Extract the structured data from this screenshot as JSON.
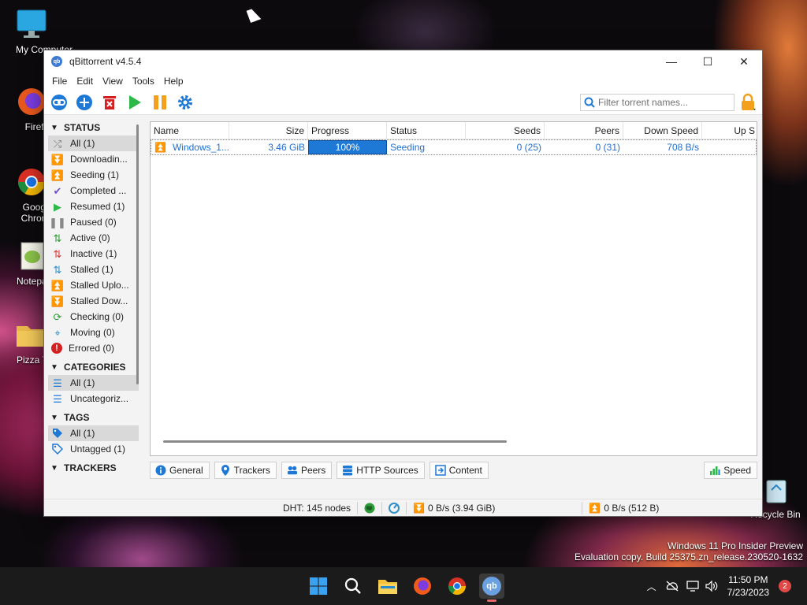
{
  "desktop": {
    "icons": [
      {
        "label": "My Computer",
        "icon": "monitor-icon"
      },
      {
        "label": "Firefox",
        "icon": "firefox-icon"
      },
      {
        "label": "Google Chrome",
        "icon": "chrome-icon"
      },
      {
        "label": "Notepad++",
        "icon": "notepad-icon"
      },
      {
        "label": "Pizza Tower",
        "icon": "folder-icon"
      }
    ],
    "recycle_bin": "Recycle Bin",
    "watermark": {
      "line1": "Windows 11 Pro Insider Preview",
      "line2": "Evaluation copy. Build 25375.zn_release.230520-1632"
    }
  },
  "window": {
    "title": "qBittorrent v4.5.4",
    "app_icon_text": "qb",
    "controls": {
      "minimize": "—",
      "maximize": "☐",
      "close": "✕"
    }
  },
  "menu": [
    "File",
    "Edit",
    "View",
    "Tools",
    "Help"
  ],
  "toolbar": {
    "buttons": [
      "add-link-icon",
      "add-torrent-icon",
      "delete-icon",
      "resume-icon",
      "pause-icon",
      "options-icon"
    ],
    "search_placeholder": "Filter torrent names..."
  },
  "sidebar": {
    "status": {
      "heading": "STATUS",
      "items": [
        {
          "label": "All (1)",
          "icon": "shuffle-icon",
          "color": "#777777",
          "glyph": "⤮",
          "selected": true
        },
        {
          "label": "Downloadin...",
          "icon": "download-icon",
          "color": "#2e9a38",
          "glyph": "⏬"
        },
        {
          "label": "Seeding (1)",
          "icon": "upload-icon",
          "color": "#3a7bd1",
          "glyph": "⏫"
        },
        {
          "label": "Completed ...",
          "icon": "checkmark-icon",
          "color": "#7050c8",
          "glyph": "✔"
        },
        {
          "label": "Resumed (1)",
          "icon": "play-icon",
          "color": "#2eb84a",
          "glyph": "▶"
        },
        {
          "label": "Paused (0)",
          "icon": "pause-icon",
          "color": "#888888",
          "glyph": "❚❚"
        },
        {
          "label": "Active (0)",
          "icon": "active-arrows-icon",
          "color": "#2e9a38",
          "glyph": "⇅"
        },
        {
          "label": "Inactive (1)",
          "icon": "inactive-arrows-icon",
          "color": "#d43a3a",
          "glyph": "⇅"
        },
        {
          "label": "Stalled (1)",
          "icon": "stalled-arrows-icon",
          "color": "#2e8fc8",
          "glyph": "⇅"
        },
        {
          "label": "Stalled Uplo...",
          "icon": "stalled-upload-icon",
          "color": "#3a7bd1",
          "glyph": "⏫"
        },
        {
          "label": "Stalled Dow...",
          "icon": "stalled-download-icon",
          "color": "#2e9a38",
          "glyph": "⏬"
        },
        {
          "label": "Checking (0)",
          "icon": "refresh-icon",
          "color": "#2e9a38",
          "glyph": "⟳"
        },
        {
          "label": "Moving (0)",
          "icon": "move-icon",
          "color": "#2e8fc8",
          "glyph": "⌖"
        },
        {
          "label": "Errored (0)",
          "icon": "error-icon",
          "color": "#d42020",
          "glyph": "!"
        }
      ]
    },
    "categories": {
      "heading": "CATEGORIES",
      "items": [
        {
          "label": "All (1)",
          "icon": "list-icon",
          "selected": true
        },
        {
          "label": "Uncategoriz...",
          "icon": "list-icon",
          "selected": false
        }
      ]
    },
    "tags": {
      "heading": "TAGS",
      "items": [
        {
          "label": "All (1)",
          "icon": "tag-icon",
          "selected": true
        },
        {
          "label": "Untagged (1)",
          "icon": "tag-outline-icon",
          "selected": false
        }
      ]
    },
    "trackers": {
      "heading": "TRACKERS"
    }
  },
  "table": {
    "columns": [
      "Name",
      "Size",
      "Progress",
      "Status",
      "Seeds",
      "Peers",
      "Down Speed",
      "Up S"
    ],
    "rows": [
      {
        "name": "Windows_1...",
        "size": "3.46 GiB",
        "progress": 1.0,
        "progress_text": "100%",
        "status": "Seeding",
        "seeds": "0 (25)",
        "peers": "0 (31)",
        "down_speed": "708 B/s"
      }
    ]
  },
  "tabs": [
    "General",
    "Trackers",
    "Peers",
    "HTTP Sources",
    "Content"
  ],
  "speed_tab": "Speed",
  "statusbar": {
    "dht": "DHT: 145 nodes",
    "download": "0 B/s (3.94 GiB)",
    "upload": "0 B/s (512 B)"
  },
  "taskbar": {
    "apps": [
      "windows-start-icon",
      "search-icon",
      "file-explorer-icon",
      "firefox-icon",
      "chrome-icon",
      "qbittorrent-icon"
    ],
    "qb_label": "qb",
    "time": "11:50 PM",
    "date": "7/23/2023",
    "notification_count": "2"
  },
  "colors": {
    "accent_blue": "#1e78d6",
    "status_seeding": "#1f6fcf"
  }
}
